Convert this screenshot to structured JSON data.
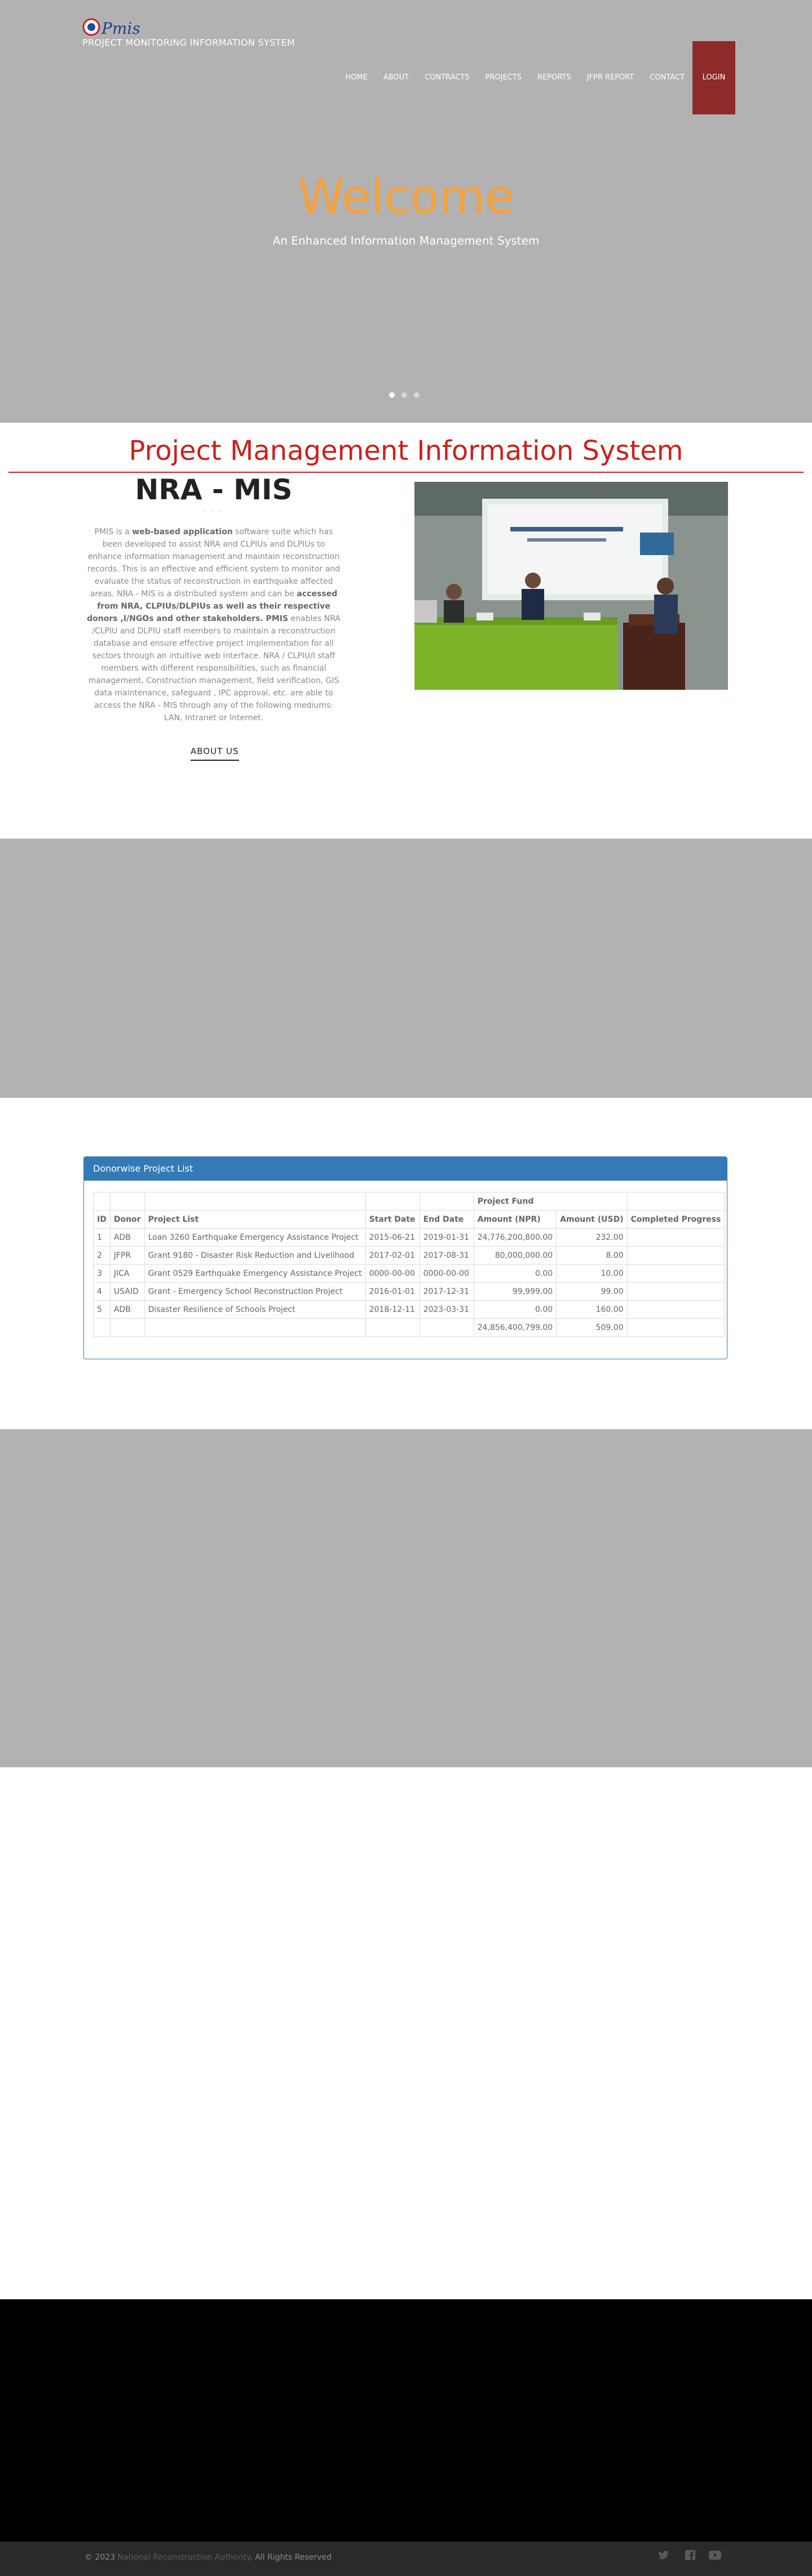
{
  "header": {
    "logo_text": "Pmis",
    "subtitle": "PROJECT MONITORING INFORMATION SYSTEM",
    "nav": [
      "HOME",
      "ABOUT",
      "CONTRACTS",
      "PROJECTS",
      "REPORTS",
      "JFPR REPORT",
      "CONTACT"
    ],
    "login": "LOGIN"
  },
  "hero": {
    "title": "Welcome",
    "subtitle": "An Enhanced Information Management System",
    "slides": 3,
    "active_slide": 1
  },
  "intro": {
    "section_title": "Project Management Information System",
    "heading": "NRA - MIS",
    "dots": ". . .",
    "body_parts": [
      {
        "t": "PMIS is a ",
        "b": false
      },
      {
        "t": "web-based application",
        "b": true
      },
      {
        "t": " software suite which has been developed to assist NRA and CLPIUs and DLPIUs to enhance information management and maintain reconstruction records. This is an effective and efficient system to monitor and evaluate the status of reconstruction in earthquake affected areas. NRA - MIS is a distributed system and can be ",
        "b": false
      },
      {
        "t": "accessed from NRA, CLPIUs/DLPIUs as well as their respective donors ,I/NGOs and other stakeholders. PMIS",
        "b": true
      },
      {
        "t": " enables NRA /CLPIU and DLPIU staff members to maintain a reconstruction database and ensure effective project implementation for all sectors through an intuitive web interface. NRA / CLPIU/I staff members with different responsibilities, such as financial management, Construction management, field verification, GIS data maintenance, safeguard , IPC approval, etc. are able to access the NRA - MIS through any of the following mediums: LAN, Intranet or Internet.",
        "b": false
      }
    ],
    "about_link": "ABOUT US"
  },
  "donor_panel": {
    "title": "Donorwise Project List",
    "group_header": "Project Fund",
    "columns": [
      "ID",
      "Donor",
      "Project List",
      "Start Date",
      "End Date",
      "Amount (NPR)",
      "Amount (USD)",
      "Completed Progress"
    ],
    "rows": [
      [
        "1",
        "ADB",
        "Loan 3260 Earthquake Emergency Assistance Project",
        "2015-06-21",
        "2019-01-31",
        "24,776,200,800.00",
        "232.00",
        ""
      ],
      [
        "2",
        "JFPR",
        "Grant 9180 - Disaster Risk Reduction and Livelihood",
        "2017-02-01",
        "2017-08-31",
        "80,000,000.00",
        "8.00",
        ""
      ],
      [
        "3",
        "JICA",
        "Grant 0529 Earthquake Emergency Assistance Project",
        "0000-00-00",
        "0000-00-00",
        "0.00",
        "10.00",
        ""
      ],
      [
        "4",
        "USAID",
        "Grant - Emergency School Reconstruction Project",
        "2016-01-01",
        "2017-12-31",
        "99,999.00",
        "99.00",
        ""
      ],
      [
        "5",
        "ADB",
        "Disaster Resilience of Schools Project",
        "2018-12-11",
        "2023-03-31",
        "0.00",
        "160.00",
        ""
      ]
    ],
    "total_npr": "24,856,400,799.00",
    "total_usd": "509.00"
  },
  "footer": {
    "copyright_prefix": "© 2023",
    "org": "National Reconstruction Authority",
    "rights": ". All Rights Reserved",
    "social_icons": [
      "twitter-icon",
      "facebook-icon",
      "youtube-icon"
    ]
  }
}
